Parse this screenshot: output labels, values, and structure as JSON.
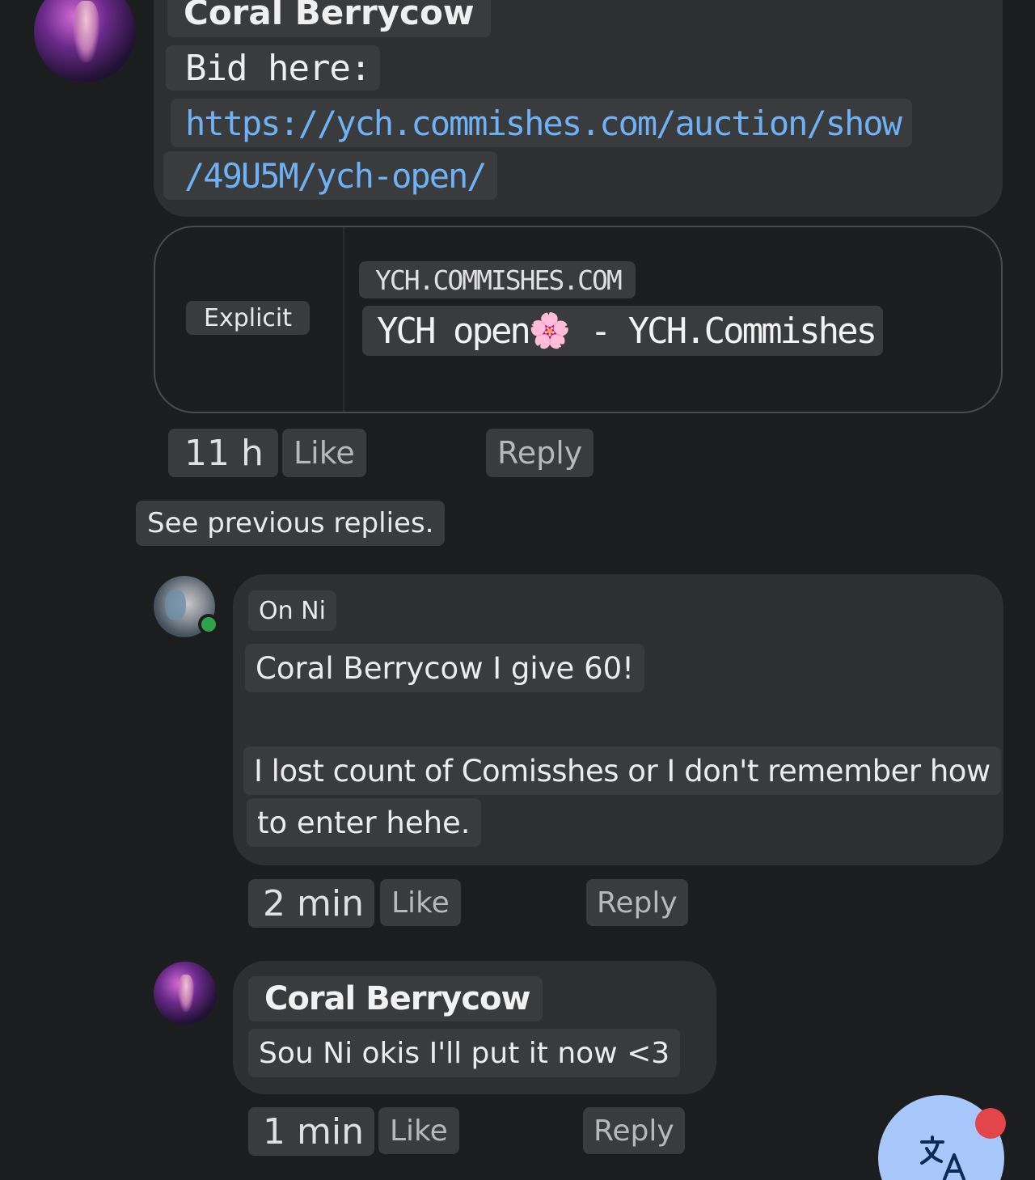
{
  "first_comment": {
    "author": "Coral Berrycow",
    "lines": [
      "Bid here:"
    ],
    "link_lines": [
      "https://ych.commishes.com/auction/show",
      "/49U5M/ych-open/"
    ],
    "time": "11 h",
    "like_label": "Like",
    "reply_label": "Reply"
  },
  "link_preview": {
    "badge": "Explicit",
    "domain": "YCH.COMMISHES.COM",
    "title_before": "YCH open",
    "title_emoji": "🌸",
    "title_after": " - YCH.Commishes"
  },
  "see_previous": "See previous replies.",
  "reply_1": {
    "author": "On Ni",
    "lines": [
      "Coral Berrycow I give 60!",
      "I lost count of Comisshes or I don't remember how",
      "to enter hehe."
    ],
    "time": "2 min",
    "like_label": "Like",
    "reply_label": "Reply"
  },
  "reply_2": {
    "author": "Coral Berrycow",
    "lines": [
      "Sou Ni okis I'll put it now <3"
    ],
    "time": "1 min",
    "like_label": "Like",
    "reply_label": "Reply"
  },
  "fab": {
    "icon": "translate-icon"
  },
  "colors": {
    "background": "#1c1d1f",
    "bubble": "#2e2f31",
    "chip": "#3a3b3d",
    "link": "#6fb1f5",
    "online": "#31a24c",
    "fab": "#a8c7fa",
    "badge": "#e2454a"
  }
}
